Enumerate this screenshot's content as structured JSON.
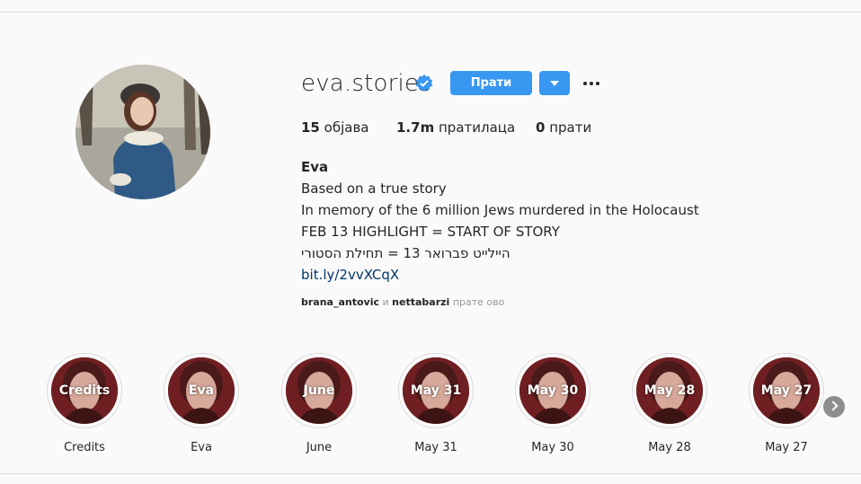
{
  "profile": {
    "username": "eva.stories",
    "verified": true,
    "follow_label": "Прати",
    "more_icon": "more-options-icon",
    "avatar_icon": "profile-photo",
    "stats": {
      "posts_count": "15",
      "posts_label": "објава",
      "followers_count": "1.7m",
      "followers_label": "пратилаца",
      "following_count": "0",
      "following_label": "прати"
    },
    "bio": {
      "name": "Eva",
      "line1": "Based on a true story",
      "line2": "In memory of the 6 million Jews murdered in the Holocaust",
      "line3": "FEB 13 HIGHLIGHT = START OF STORY",
      "line4": "היילייט פברואר 13 = תחילת הסטורי",
      "link": "bit.ly/2vvXCqX"
    },
    "followed_by": {
      "user1": "brana_antovic",
      "connector": "и",
      "user2": "nettabarzi",
      "suffix": "прате ово"
    }
  },
  "highlights": [
    {
      "overlay": "Credits",
      "label": "Credits"
    },
    {
      "overlay": "Eva",
      "label": "Eva"
    },
    {
      "overlay": "June",
      "label": "June"
    },
    {
      "overlay": "May 31",
      "label": "May 31"
    },
    {
      "overlay": "May 30",
      "label": "May 30"
    },
    {
      "overlay": "May 28",
      "label": "May 28"
    },
    {
      "overlay": "May 27",
      "label": "May 27"
    }
  ],
  "colors": {
    "accent": "#3897f0",
    "link": "#003569",
    "verified": "#3897f0",
    "highlight_bg": "#6f1f22"
  }
}
